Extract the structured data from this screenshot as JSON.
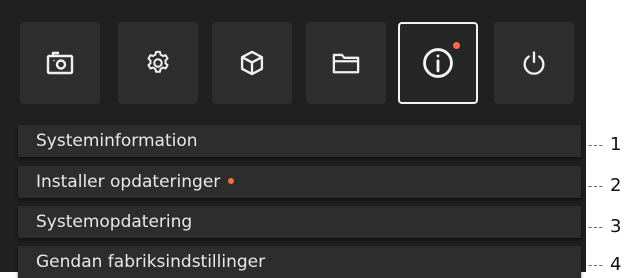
{
  "colors": {
    "panel_bg": "#202020",
    "button_bg": "#2e2e2e",
    "item_bg": "#2d2d2d",
    "text": "#e8e8e8",
    "accent_dot": "#ff6a3d",
    "active_border": "#f2f2f2"
  },
  "toolbar": {
    "buttons": [
      {
        "icon": "camera-icon",
        "active": false
      },
      {
        "icon": "gear-icon",
        "active": false
      },
      {
        "icon": "cube-icon",
        "active": false
      },
      {
        "icon": "folder-icon",
        "active": false
      },
      {
        "icon": "info-icon",
        "active": true,
        "notification": true
      },
      {
        "icon": "power-icon",
        "active": false
      }
    ]
  },
  "menu": {
    "items": [
      {
        "label": "Systeminformation",
        "notification": false
      },
      {
        "label": "Installer opdateringer",
        "notification": true
      },
      {
        "label": "Systemopdatering",
        "notification": false
      },
      {
        "label": "Gendan fabriksindstillinger",
        "notification": false
      }
    ]
  },
  "callouts": [
    {
      "dash": "---",
      "number": "1"
    },
    {
      "dash": "---",
      "number": "2"
    },
    {
      "dash": "---",
      "number": "3"
    },
    {
      "dash": "---",
      "number": "4"
    }
  ]
}
